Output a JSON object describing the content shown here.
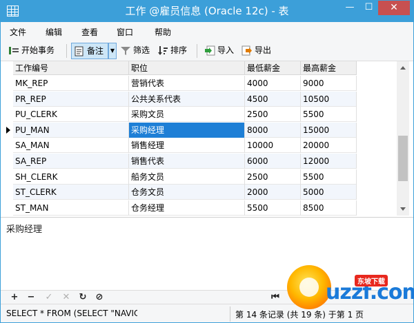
{
  "window": {
    "title": "工作 @雇员信息 (Oracle 12c) - 表",
    "min_glyph": "—",
    "max_glyph": "☐",
    "close_glyph": "✕"
  },
  "menu": [
    "文件",
    "编辑",
    "查看",
    "窗口",
    "帮助"
  ],
  "toolbar": {
    "begin_transaction": "开始事务",
    "memo": "备注",
    "filter": "筛选",
    "sort": "排序",
    "import": "导入",
    "export": "导出"
  },
  "grid": {
    "columns": [
      "工作编号",
      "职位",
      "最低薪金",
      "最高薪金"
    ],
    "rows": [
      [
        "MK_REP",
        "营销代表",
        "4000",
        "9000"
      ],
      [
        "PR_REP",
        "公共关系代表",
        "4500",
        "10500"
      ],
      [
        "PU_CLERK",
        "采购文员",
        "2500",
        "5500"
      ],
      [
        "PU_MAN",
        "采购经理",
        "8000",
        "15000"
      ],
      [
        "SA_MAN",
        "销售经理",
        "10000",
        "20000"
      ],
      [
        "SA_REP",
        "销售代表",
        "6000",
        "12000"
      ],
      [
        "SH_CLERK",
        "船务文员",
        "2500",
        "5500"
      ],
      [
        "ST_CLERK",
        "仓务文员",
        "2000",
        "5000"
      ],
      [
        "ST_MAN",
        "仓务经理",
        "5500",
        "8500"
      ]
    ],
    "current_row": 3,
    "selected_cell": "采购经理"
  },
  "memo": {
    "text": "采购经理"
  },
  "nav": {
    "add": "+",
    "delete": "−",
    "apply": "✓",
    "discard": "✕",
    "refresh": "↻",
    "stop": "⊘",
    "first": "⏮"
  },
  "status": {
    "sql": "SELECT * FROM (SELECT \"NAVIC",
    "record": "第 14 条记录 (共 19 条) 于第 1 页"
  },
  "watermark": {
    "text": "uzzf.com",
    "badge": "东坡下载"
  },
  "colors": {
    "titlebar": "#3c9fd9",
    "close": "#c75050",
    "selection": "#1e7fd6",
    "alt_row": "#f2f6fc"
  }
}
